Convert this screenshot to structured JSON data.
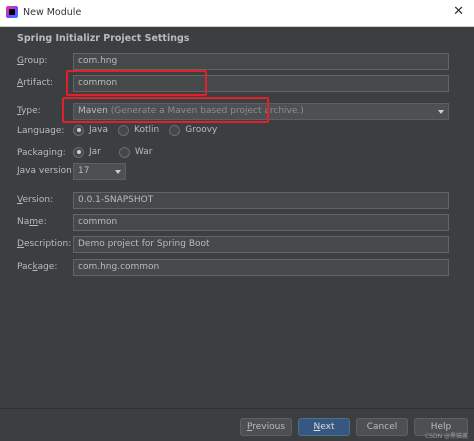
{
  "window": {
    "title": "New Module",
    "close_glyph": "✕"
  },
  "section_title": "Spring Initializr Project Settings",
  "fields": {
    "group": {
      "label_pre": "",
      "label_mn": "G",
      "label_post": "roup:",
      "value": "com.hng"
    },
    "artifact": {
      "label_pre": "",
      "label_mn": "A",
      "label_post": "rtifact:",
      "value": "common"
    },
    "type": {
      "label_pre": "",
      "label_mn": "T",
      "label_post": "ype:",
      "value": "Maven",
      "hint": "(Generate a Maven based project archive.)"
    },
    "language": {
      "label": "Language:",
      "options": [
        "Java",
        "Kotlin",
        "Groovy"
      ],
      "selected": "Java"
    },
    "packaging": {
      "label": "Packaging:",
      "options": [
        "Jar",
        "War"
      ],
      "selected": "Jar"
    },
    "java_version": {
      "label_pre": "",
      "label_mn": "J",
      "label_post": "ava version:",
      "value": "17"
    },
    "version": {
      "label_pre": "",
      "label_mn": "V",
      "label_post": "ersion:",
      "value": "0.0.1-SNAPSHOT"
    },
    "name": {
      "label_pre": "Na",
      "label_mn": "m",
      "label_post": "e:",
      "value": "common"
    },
    "description": {
      "label_pre": "",
      "label_mn": "D",
      "label_post": "escription:",
      "value": "Demo project for Spring Boot"
    },
    "package": {
      "label_pre": "Pac",
      "label_mn": "k",
      "label_post": "age:",
      "value": "com.hng.common"
    }
  },
  "buttons": {
    "previous": {
      "pre": "",
      "mn": "P",
      "post": "revious"
    },
    "next": {
      "pre": "",
      "mn": "N",
      "post": "ext"
    },
    "cancel": {
      "label": "Cancel"
    },
    "help": {
      "label": "Help"
    }
  },
  "highlight_color": "#e0202a",
  "watermark": "CSDN @黑猫酱"
}
